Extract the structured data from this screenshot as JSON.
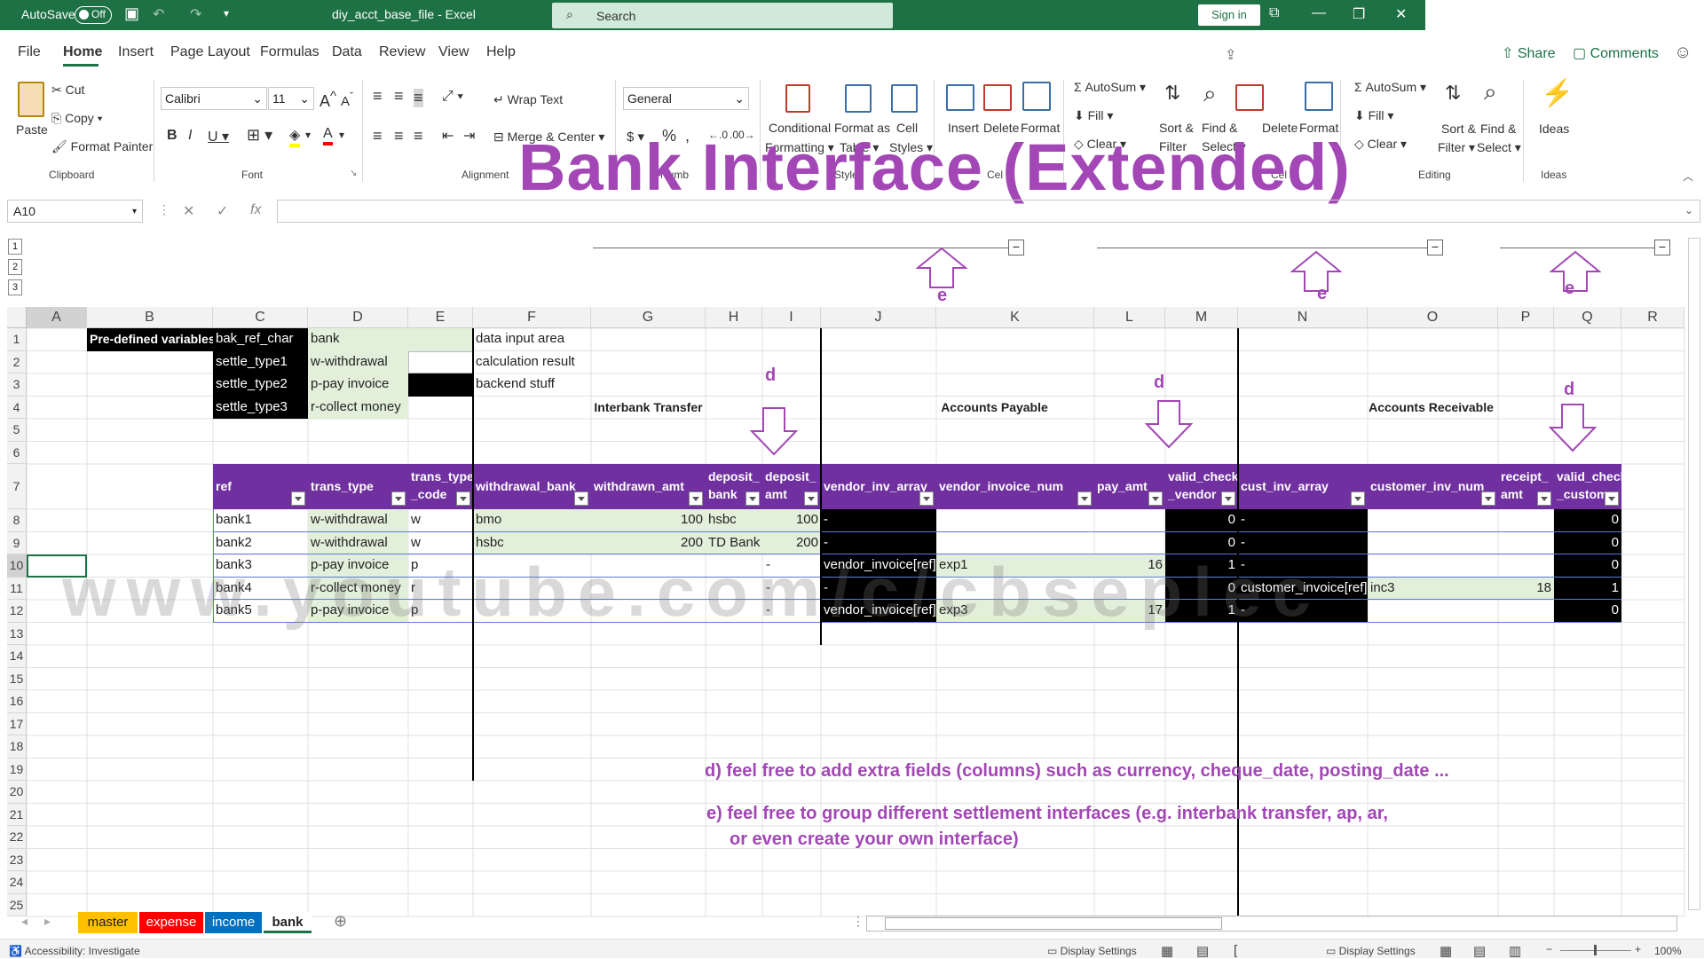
{
  "titlebar": {
    "autosave": "AutoSave",
    "autosave_state": "Off",
    "filename": "diy_acct_base_file  -  Excel",
    "search": "Search",
    "signin": "Sign in"
  },
  "menu": [
    "File",
    "Home",
    "Insert",
    "Page Layout",
    "Formulas",
    "Data",
    "Review",
    "View",
    "Help"
  ],
  "share": "Share",
  "comments": "Comments",
  "ribbon": {
    "paste": "Paste",
    "cut": "Cut",
    "copy": "Copy",
    "format_painter": "Format Painter",
    "font": "Calibri",
    "size": "11",
    "wrap": "Wrap Text",
    "merge": "Merge & Center",
    "numfmt": "General",
    "cond1": "Conditional",
    "cond2": "Formatting",
    "fat1": "Format as",
    "fat2": "Table",
    "cs1": "Cell",
    "cs2": "Styles",
    "insert": "Insert",
    "delete": "Delete",
    "format": "Format",
    "autosum": "AutoSum",
    "fill": "Fill",
    "clear": "Clear",
    "sort1": "Sort &",
    "sort2": "Filter",
    "find1": "Find &",
    "find2": "Select",
    "ideas": "Ideas",
    "groups": {
      "clipboard": "Clipboard",
      "font": "Font",
      "alignment": "Alignment",
      "number": "Numb",
      "styles": "Styles",
      "cells": "Cel",
      "editing": "Editing",
      "ideas": "Ideas"
    }
  },
  "overlay_title": "Bank Interface (Extended)",
  "namebox": "A10",
  "columns": [
    "A",
    "B",
    "C",
    "D",
    "E",
    "F",
    "G",
    "H",
    "I",
    "J",
    "K",
    "L",
    "M",
    "N",
    "O",
    "P",
    "Q",
    "R"
  ],
  "rows": [
    "1",
    "2",
    "3",
    "4",
    "5",
    "6",
    "7",
    "8",
    "9",
    "10",
    "11",
    "12",
    "13",
    "14",
    "15",
    "16",
    "17",
    "18",
    "19",
    "20",
    "21",
    "22",
    "23",
    "24",
    "25"
  ],
  "outline_levels": [
    "1",
    "2",
    "3"
  ],
  "predefined": {
    "label": "Pre-defined variables",
    "vars": [
      [
        "bak_ref_char",
        "bank"
      ],
      [
        "settle_type1",
        "w-withdrawal"
      ],
      [
        "settle_type2",
        "p-pay invoice"
      ],
      [
        "settle_type3",
        "r-collect money"
      ]
    ]
  },
  "legend": [
    "data input area",
    "calculation result",
    "backend stuff"
  ],
  "sections": {
    "interbank": "Interbank Transfer",
    "ap": "Accounts Payable",
    "ar": "Accounts Receivable"
  },
  "table_headers": {
    "ref": "ref",
    "trans_type": "trans_type",
    "trans_type_code": [
      "trans_type",
      "_code"
    ],
    "withdrawal_bank": "withdrawal_bank",
    "withdrawn_amt": "withdrawn_amt",
    "deposit_bank": [
      "deposit_",
      "bank"
    ],
    "deposit_amt": [
      "deposit_",
      "amt"
    ],
    "vendor_inv_array": "vendor_inv_array",
    "vendor_invoice_num": "vendor_invoice_num",
    "pay_amt": "pay_amt",
    "valid_check_vendor": [
      "valid_check",
      "_vendor"
    ],
    "cust_inv_array": "cust_inv_array",
    "customer_inv_num": "customer_inv_num",
    "receipt_amt": [
      "receipt_",
      "amt"
    ],
    "valid_check_customer": [
      "valid_check",
      "_custome"
    ]
  },
  "table_rows": [
    {
      "ref": "bank1",
      "type": "w-withdrawal",
      "code": "w",
      "wbank": "bmo",
      "wamt": "100",
      "dbank": "hsbc",
      "damt": "100",
      "varr": "-",
      "vnum": "",
      "pay": "",
      "vchk": "0",
      "carr": "-",
      "cnum": "",
      "rec": "",
      "cchk": "0"
    },
    {
      "ref": "bank2",
      "type": "w-withdrawal",
      "code": "w",
      "wbank": "hsbc",
      "wamt": "200",
      "dbank": "TD Bank",
      "damt": "200",
      "varr": "-",
      "vnum": "",
      "pay": "",
      "vchk": "0",
      "carr": "-",
      "cnum": "",
      "rec": "",
      "cchk": "0"
    },
    {
      "ref": "bank3",
      "type": "p-pay invoice",
      "code": "p",
      "wbank": "",
      "wamt": "",
      "dbank": "",
      "damt": "-",
      "varr": "vendor_invoice[ref]",
      "vnum": "exp1",
      "pay": "16",
      "vchk": "1",
      "carr": "-",
      "cnum": "",
      "rec": "",
      "cchk": "0"
    },
    {
      "ref": "bank4",
      "type": "r-collect money",
      "code": "r",
      "wbank": "",
      "wamt": "",
      "dbank": "",
      "damt": "-",
      "varr": "-",
      "vnum": "",
      "pay": "",
      "vchk": "0",
      "carr": "customer_invoice[ref]",
      "cnum": "inc3",
      "rec": "18",
      "cchk": "1"
    },
    {
      "ref": "bank5",
      "type": "p-pay invoice",
      "code": "p",
      "wbank": "",
      "wamt": "",
      "dbank": "",
      "damt": "-",
      "varr": "vendor_invoice[ref]",
      "vnum": "exp3",
      "pay": "17",
      "vchk": "1",
      "carr": "-",
      "cnum": "",
      "rec": "",
      "cchk": "0"
    }
  ],
  "annotations": {
    "d": "d",
    "e": "e",
    "note_d": "d) feel free to add extra fields (columns) such as currency, cheque_date, posting_date ...",
    "note_e1": "e) feel free to group different settlement interfaces (e.g. interbank transfer, ap, ar,",
    "note_e2": "or even create your own interface)"
  },
  "watermark": "www.youtube.com/c/cbseplec",
  "sheets": [
    {
      "name": "master",
      "color": "#ffc000"
    },
    {
      "name": "expense",
      "color": "#ff0000"
    },
    {
      "name": "income",
      "color": "#0070c0"
    },
    {
      "name": "bank",
      "color": "#ffffff"
    }
  ],
  "status": {
    "accessibility": "Accessibility: Investigate",
    "display": "Display Settings",
    "zoom": "100%"
  }
}
